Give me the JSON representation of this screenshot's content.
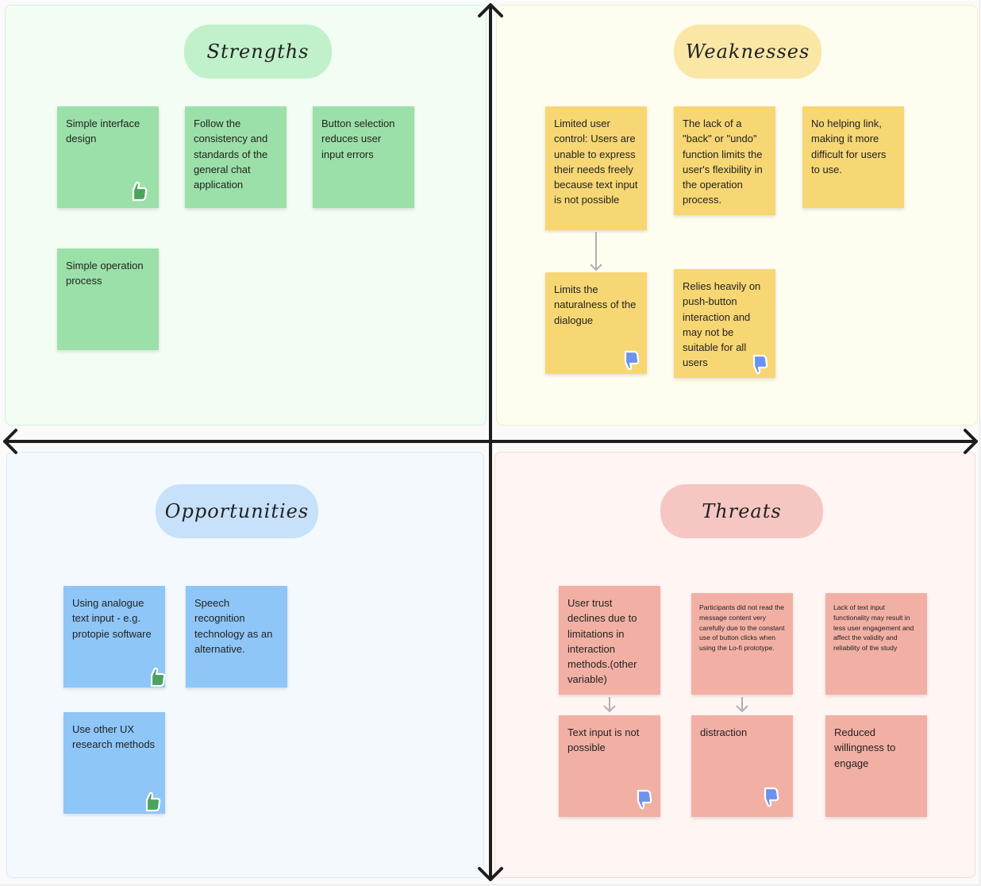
{
  "board": {
    "quadrants": {
      "strengths": {
        "title": "Strengths",
        "notes": [
          {
            "text": "Simple interface design",
            "sticker": "thumbs-up"
          },
          {
            "text": "Follow the consistency and standards of the general chat application",
            "sticker": null
          },
          {
            "text": "Button selection reduces user input errors",
            "sticker": null
          },
          {
            "text": "Simple operation process",
            "sticker": null
          }
        ]
      },
      "weaknesses": {
        "title": "Weaknesses",
        "notes": [
          {
            "text": "Limited user control: Users are unable to express their needs freely because text input is not possible",
            "sticker": null
          },
          {
            "text": "The lack of a \"back\" or \"undo\" function limits the user's flexibility in the operation process.",
            "sticker": null
          },
          {
            "text": "No helping link, making it more difficult for users to use.",
            "sticker": null
          },
          {
            "text": "Limits the naturalness of the dialogue",
            "sticker": "thumbs-down"
          },
          {
            "text": "Relies heavily on push-button interaction and may not be suitable for all users",
            "sticker": "thumbs-down"
          }
        ]
      },
      "opportunities": {
        "title": "Opportunities",
        "notes": [
          {
            "text": "Using analogue text input - e.g. protopie software",
            "sticker": "thumbs-up"
          },
          {
            "text": "Speech recognition technology as an alternative.",
            "sticker": null
          },
          {
            "text": "Use other UX research methods",
            "sticker": "thumbs-up"
          }
        ]
      },
      "threats": {
        "title": "Threats",
        "notes": [
          {
            "text": "User trust declines due to limitations in interaction methods.(other variable)",
            "sticker": null
          },
          {
            "text": "Participants did not read the message content very carefully due to the constant use of button clicks when using the Lo-fi prototype.",
            "sticker": null
          },
          {
            "text": "Lack of text input functionality may result in less user engagement and affect the validity and reliability of the study",
            "sticker": null
          },
          {
            "text": "Text input is not possible",
            "sticker": "thumbs-down"
          },
          {
            "text": "distraction",
            "sticker": "thumbs-down"
          },
          {
            "text": "Reduced willingness to engage",
            "sticker": null
          }
        ]
      }
    },
    "colors": {
      "strengths_note": "#9be0a8",
      "weaknesses_note": "#f7d774",
      "opportunities_note": "#8ec6f8",
      "threats_note": "#f2b0a5",
      "thumbs_up": "#4ca35e",
      "thumbs_down": "#6b93ee",
      "axis": "#1e1e1e"
    }
  }
}
